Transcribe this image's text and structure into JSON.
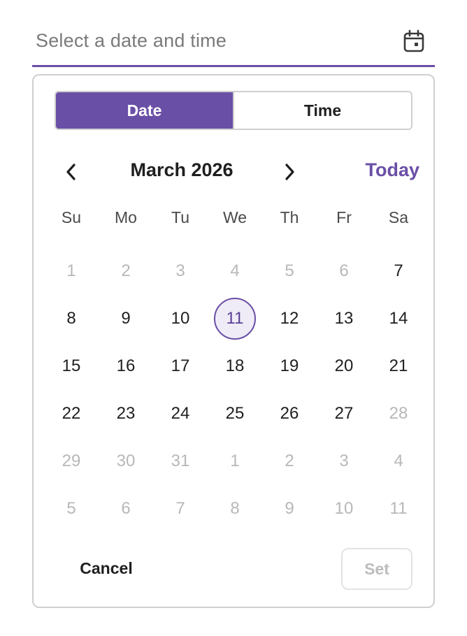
{
  "field": {
    "placeholder": "Select a date and time",
    "icon": "calendar-icon"
  },
  "tabs": [
    {
      "label": "Date",
      "active": true
    },
    {
      "label": "Time",
      "active": false
    }
  ],
  "calendar": {
    "month_title": "March 2026",
    "today_label": "Today",
    "prev_icon": "chevron-left-icon",
    "next_icon": "chevron-right-icon",
    "weekdays": [
      "Su",
      "Mo",
      "Tu",
      "We",
      "Th",
      "Fr",
      "Sa"
    ],
    "days": [
      {
        "label": "1",
        "muted": true
      },
      {
        "label": "2",
        "muted": true
      },
      {
        "label": "3",
        "muted": true
      },
      {
        "label": "4",
        "muted": true
      },
      {
        "label": "5",
        "muted": true
      },
      {
        "label": "6",
        "muted": true
      },
      {
        "label": "7",
        "muted": false
      },
      {
        "label": "8",
        "muted": false
      },
      {
        "label": "9",
        "muted": false
      },
      {
        "label": "10",
        "muted": false
      },
      {
        "label": "11",
        "muted": false,
        "selected": true
      },
      {
        "label": "12",
        "muted": false
      },
      {
        "label": "13",
        "muted": false
      },
      {
        "label": "14",
        "muted": false
      },
      {
        "label": "15",
        "muted": false
      },
      {
        "label": "16",
        "muted": false
      },
      {
        "label": "17",
        "muted": false
      },
      {
        "label": "18",
        "muted": false
      },
      {
        "label": "19",
        "muted": false
      },
      {
        "label": "20",
        "muted": false
      },
      {
        "label": "21",
        "muted": false
      },
      {
        "label": "22",
        "muted": false
      },
      {
        "label": "23",
        "muted": false
      },
      {
        "label": "24",
        "muted": false
      },
      {
        "label": "25",
        "muted": false
      },
      {
        "label": "26",
        "muted": false
      },
      {
        "label": "27",
        "muted": false
      },
      {
        "label": "28",
        "muted": true
      },
      {
        "label": "29",
        "muted": true
      },
      {
        "label": "30",
        "muted": true
      },
      {
        "label": "31",
        "muted": true
      },
      {
        "label": "1",
        "muted": true
      },
      {
        "label": "2",
        "muted": true
      },
      {
        "label": "3",
        "muted": true
      },
      {
        "label": "4",
        "muted": true
      },
      {
        "label": "5",
        "muted": true
      },
      {
        "label": "6",
        "muted": true
      },
      {
        "label": "7",
        "muted": true
      },
      {
        "label": "8",
        "muted": true
      },
      {
        "label": "9",
        "muted": true
      },
      {
        "label": "10",
        "muted": true
      },
      {
        "label": "11",
        "muted": true
      }
    ]
  },
  "actions": {
    "cancel_label": "Cancel",
    "set_label": "Set",
    "set_disabled": true
  },
  "colors": {
    "accent": "#6a4fa6",
    "muted_text": "#b8b8b8",
    "border": "#cfcfcf"
  }
}
